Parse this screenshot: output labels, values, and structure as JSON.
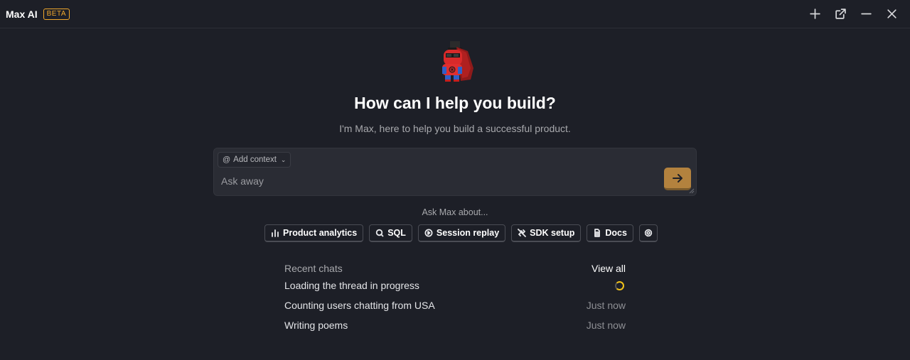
{
  "window": {
    "title": "Max AI",
    "badge": "BETA"
  },
  "header_actions": [
    {
      "name": "new-chat",
      "icon": "plus-icon"
    },
    {
      "name": "open-external",
      "icon": "external-link-icon"
    },
    {
      "name": "minimize",
      "icon": "minus-icon"
    },
    {
      "name": "close",
      "icon": "close-icon"
    }
  ],
  "hero": {
    "headline": "How can I help you build?",
    "subline": "I'm Max, here to help you build a successful product."
  },
  "prompt": {
    "context_label": "Add context",
    "placeholder": "Ask away",
    "value": ""
  },
  "suggestions": {
    "label": "Ask Max about...",
    "chips": [
      {
        "label": "Product analytics",
        "icon": "bar-chart-icon"
      },
      {
        "label": "SQL",
        "icon": "sql-icon"
      },
      {
        "label": "Session replay",
        "icon": "replay-icon"
      },
      {
        "label": "SDK setup",
        "icon": "plug-icon"
      },
      {
        "label": "Docs",
        "icon": "document-icon"
      }
    ],
    "settings_icon": "gear-icon"
  },
  "recent": {
    "title": "Recent chats",
    "view_all": "View all",
    "items": [
      {
        "title": "Loading the thread in progress",
        "time": "",
        "status": "loading"
      },
      {
        "title": "Counting users chatting from USA",
        "time": "Just now"
      },
      {
        "title": "Writing poems",
        "time": "Just now"
      }
    ]
  },
  "colors": {
    "background": "#1d1f27",
    "accent": "#b3823e",
    "beta": "#f1a82c",
    "spinner": "#f1c21b"
  }
}
